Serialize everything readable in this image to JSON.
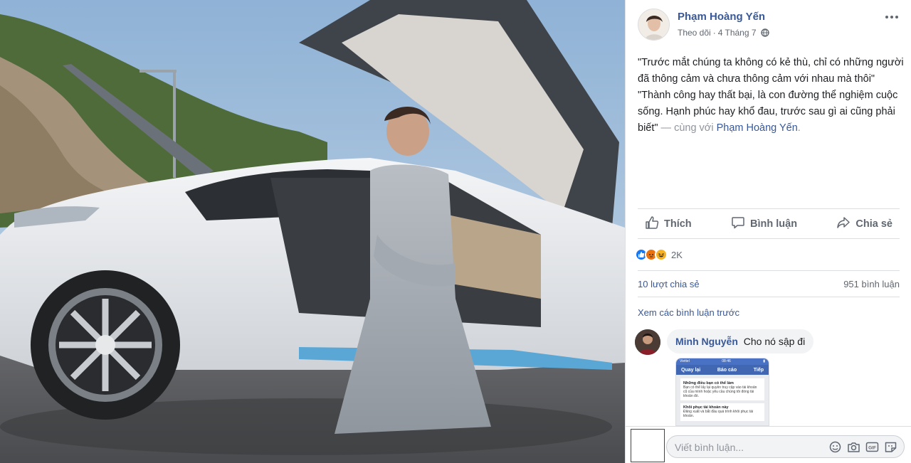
{
  "post": {
    "author": "Phạm Hoàng Yến",
    "follow_label": "Theo dõi",
    "separator": "·",
    "date": "4 Tháng 7",
    "privacy_icon": "globe-icon",
    "more_icon": "more-options-icon",
    "text_lines": [
      "\"Trước mắt chúng ta không có kẻ thù, chỉ có những người đã thông cảm và chưa thông cảm với nhau mà thôi\"",
      "\"Thành công hay thất bại, là con đường thể nghiệm cuộc sống. Hạnh phúc hay khổ đau, trước sau gì ai cũng phải biết\""
    ],
    "with_text": " — cùng với ",
    "tagged": "Phạm Hoàng Yến",
    "tagged_end": "."
  },
  "actions": {
    "like": "Thích",
    "comment": "Bình luận",
    "share": "Chia sẻ"
  },
  "reactions": {
    "types": [
      "like",
      "angry",
      "haha"
    ],
    "count": "2K"
  },
  "stats": {
    "shares": "10 lượt chia sẻ",
    "comments": "951 bình luận"
  },
  "comments_section": {
    "view_previous": "Xem các bình luận trước",
    "items": [
      {
        "name": "Minh Nguyễn",
        "text": "Cho nó sập đi",
        "attachment": {
          "carrier": "Viettel",
          "time": "08:46",
          "back": "Quay lại",
          "title": "Báo cáo",
          "next": "Tiếp",
          "heading1": "Những điều bạn có thể làm",
          "body1": "Bạn có thể lấy lại quyền truy cập vào tài khoản cũ của mình hoặc yêu cầu chúng tôi đóng tài khoản đó.",
          "heading2": "Khôi phục tài khoản này",
          "body2": "Đăng xuất và bắt đầu quá trình khôi phục tài khoản."
        }
      }
    ]
  },
  "compose": {
    "placeholder": "Viết bình luận...",
    "icons": [
      "emoji-icon",
      "camera-icon",
      "gif-icon",
      "sticker-icon"
    ]
  },
  "colors": {
    "link": "#385898",
    "muted": "#606770",
    "border": "#dadde1",
    "like_blue": "#1877f2",
    "angry": "#e9710f",
    "haha": "#f7b125"
  }
}
